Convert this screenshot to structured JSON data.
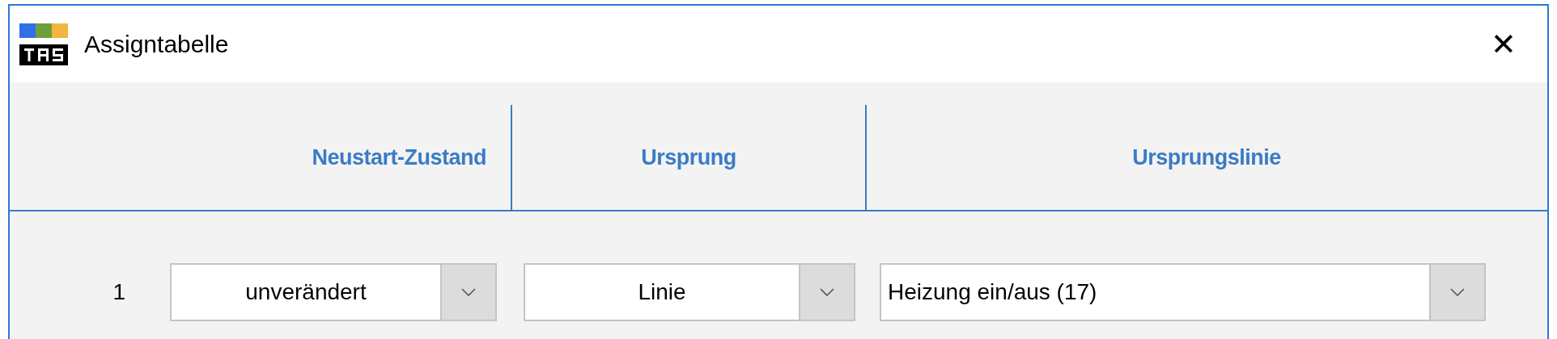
{
  "window": {
    "title": "Assigntabelle",
    "close": "✕"
  },
  "table": {
    "columns": [
      {
        "label": "Neustart-Zustand"
      },
      {
        "label": "Ursprung"
      },
      {
        "label": "Ursprungslinie"
      }
    ],
    "rows": [
      {
        "index": "1",
        "cells": [
          {
            "value": "unverändert"
          },
          {
            "value": "Linie"
          },
          {
            "value": "Heizung ein/aus (17)"
          }
        ]
      }
    ]
  }
}
